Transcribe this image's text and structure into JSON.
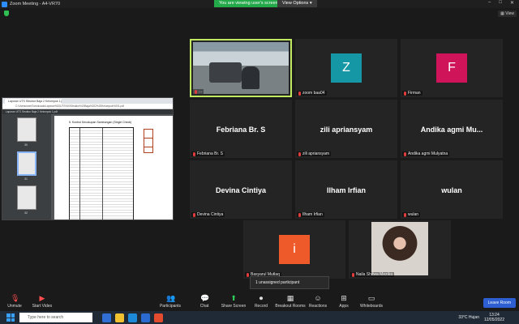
{
  "window": {
    "title": "Zoom Meeting - A4-VR70"
  },
  "banner": {
    "sharing_text": "You are viewing user's screen",
    "view_options": "View Options ▾"
  },
  "top_right": {
    "view_label": "View"
  },
  "shared_screen": {
    "tab_title": "Laporan UTS Struktur Baja 2 Kelompok 1 p...",
    "address": "C:/Users/user/Downloads/Laporan%20UTS%20Struktur%20Baja%202%20Kelompok%201.pdf",
    "pdf_toolbar": "Laporan UTS Struktur Baja 2 Kelompok 1.pdf",
    "page_heading": "5. Kontrol Kecukupan Sambungan (Single Check)",
    "thumb_numbers": [
      "30",
      "31",
      "32"
    ]
  },
  "participants": [
    {
      "name": "",
      "label": "...",
      "type": "video"
    },
    {
      "name": "",
      "label": "zoom baa04",
      "type": "avatar",
      "initial": "Z",
      "color": "#1597a5"
    },
    {
      "name": "",
      "label": "Firman",
      "type": "avatar",
      "initial": "F",
      "color": "#d0145a"
    },
    {
      "name": "Febriana Br. S",
      "label": "Febriana Br. S",
      "type": "text"
    },
    {
      "name": "zili apriansyam",
      "label": "zili apriansyam",
      "type": "text"
    },
    {
      "name": "Andika agmi Mu...",
      "label": "Andika agmi Mulyatna",
      "type": "text"
    },
    {
      "name": "Devina Cintiya",
      "label": "Devina Cintiya",
      "type": "text"
    },
    {
      "name": "Ilham Irfian",
      "label": "Ilham Irfian",
      "type": "text"
    },
    {
      "name": "wulan",
      "label": "wulan",
      "type": "text"
    },
    {
      "name": "",
      "label": "Basyarul Mutlaq",
      "type": "avatar",
      "initial": "i",
      "color": "#ef5a2a"
    },
    {
      "name": "",
      "label": "Naila Shifwa Mezika",
      "type": "photo"
    }
  ],
  "unassigned_popup": "1 unassigned participant",
  "toolbar": {
    "unmute": "Unmute",
    "start_video": "Start Video",
    "participants": "Participants",
    "participants_count": "11",
    "chat": "Chat",
    "share_screen": "Share Screen",
    "record": "Record",
    "breakout_rooms": "Breakout Rooms",
    "reactions": "Reactions",
    "apps": "Apps",
    "whiteboards": "Whiteboards",
    "leave_room": "Leave Room"
  },
  "taskbar": {
    "search_placeholder": "Type here to search",
    "weather": "33°C  Hujan",
    "time": "13:24",
    "date": "12/05/2022"
  }
}
